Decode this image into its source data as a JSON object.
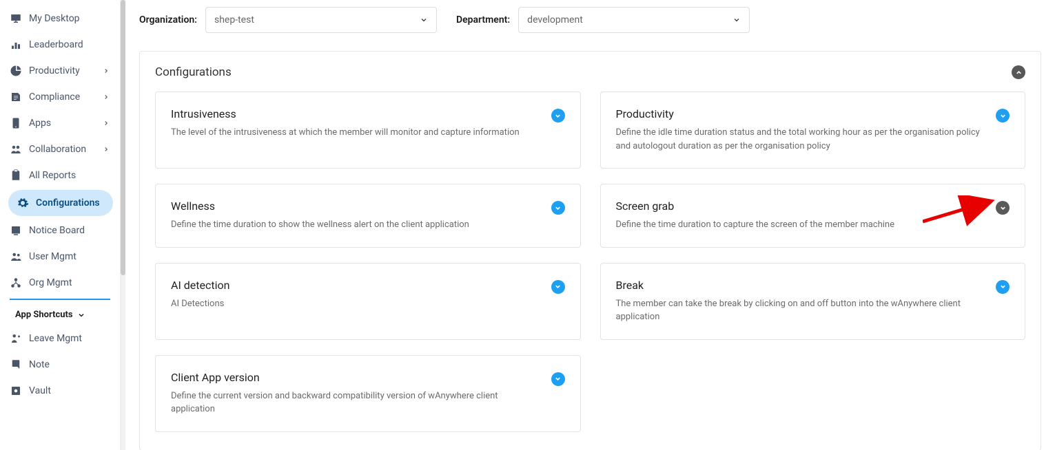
{
  "sidebar": {
    "items": [
      {
        "label": "My Desktop"
      },
      {
        "label": "Leaderboard"
      },
      {
        "label": "Productivity"
      },
      {
        "label": "Compliance"
      },
      {
        "label": "Apps"
      },
      {
        "label": "Collaboration"
      },
      {
        "label": "All Reports"
      },
      {
        "label": "Configurations"
      },
      {
        "label": "Notice Board"
      },
      {
        "label": "User Mgmt"
      },
      {
        "label": "Org Mgmt"
      }
    ],
    "section_label": "App Shortcuts",
    "shortcuts": [
      {
        "label": "Leave Mgmt"
      },
      {
        "label": "Note"
      },
      {
        "label": "Vault"
      }
    ]
  },
  "filters": {
    "org_label": "Organization:",
    "org_value": "shep-test",
    "dept_label": "Department:",
    "dept_value": "development"
  },
  "panel": {
    "title": "Configurations"
  },
  "cards": {
    "intrusiveness": {
      "title": "Intrusiveness",
      "desc": "The level of the intrusiveness at which the member will monitor and capture information"
    },
    "productivity": {
      "title": "Productivity",
      "desc": "Define the idle time duration status and the total working hour as per the organisation policy and autologout duration as per the organisation policy"
    },
    "wellness": {
      "title": "Wellness",
      "desc": "Define the time duration to show the wellness alert on the client application"
    },
    "screengrab": {
      "title": "Screen grab",
      "desc": "Define the time duration to capture the screen of the member machine"
    },
    "aidetection": {
      "title": "AI detection",
      "desc": "AI Detections"
    },
    "break": {
      "title": "Break",
      "desc": "The member can take the break by clicking on and off button into the wAnywhere client application"
    },
    "clientapp": {
      "title": "Client App version",
      "desc": "Define the current version and backward compatibility version of wAnywhere client application"
    }
  }
}
